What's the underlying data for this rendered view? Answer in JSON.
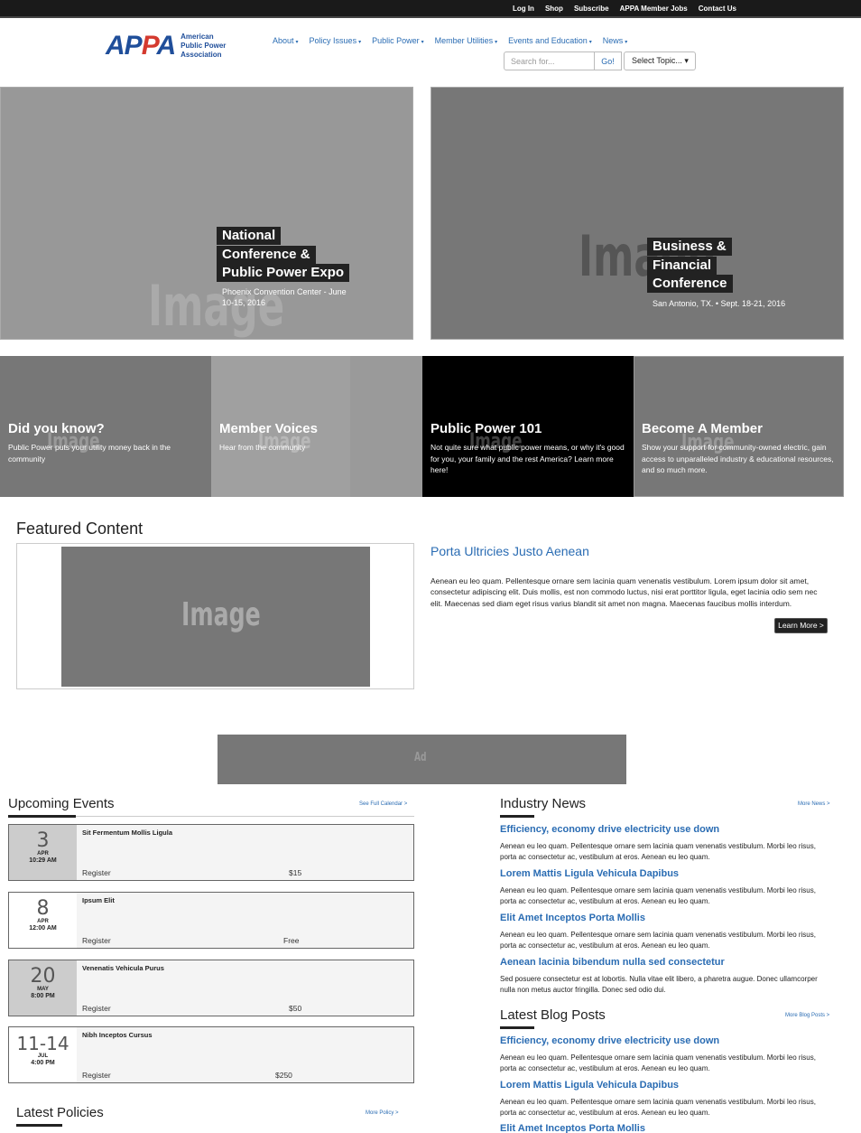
{
  "topbar": {
    "links": [
      "Log In",
      "Shop",
      "Subscribe",
      "APPA Member Jobs",
      "Contact Us"
    ]
  },
  "logo": {
    "mark_left": "AP",
    "mark_red": "P",
    "mark_right": "A",
    "text_line1": "American",
    "text_line2": "Public Power",
    "text_line3": "Association"
  },
  "nav": {
    "items": [
      "About",
      "Policy Issues",
      "Public Power",
      "Member Utilities",
      "Events and Education",
      "News"
    ],
    "caret": "▾"
  },
  "search": {
    "placeholder": "Search for...",
    "go_label": "Go!",
    "topic_label": "Select Topic... ▾"
  },
  "hero": [
    {
      "title_lines": [
        "National",
        "Conference &",
        "Public Power Expo"
      ],
      "subtitle_line1": "Phoenix Convention Center - June",
      "subtitle_line2": "10-15, 2016",
      "placeholder": "Image"
    },
    {
      "title_lines": [
        "Business &",
        "Financial",
        "Conference"
      ],
      "subtitle_line1": "San Antonio, TX. • Sept. 18-21, 2016",
      "placeholder": "Image"
    }
  ],
  "tiles": [
    {
      "title": "Did you know?",
      "desc": "Public Power puts your utility money back in the community",
      "bg": "#777777",
      "placeholder": "Image"
    },
    {
      "title": "Member Voices",
      "desc": "Hear from the community",
      "bg": "#a0a0a0",
      "placeholder": "Image"
    },
    {
      "title": "Public Power 101",
      "desc": "Not quite sure what public power means, or why it's good for you, your family and the rest America? Learn more here!",
      "bg": "#000000",
      "placeholder": "Image"
    },
    {
      "title": "Become A Member",
      "desc": "Show your support for community-owned electric, gain access to unparalleled industry & educational resources, and so much more.",
      "bg": "#777777",
      "placeholder": "Image"
    }
  ],
  "featured": {
    "heading": "Featured Content",
    "placeholder": "Image",
    "title": "Porta Ultricies Justo Aenean",
    "body": "Aenean eu leo quam. Pellentesque ornare sem lacinia quam venenatis vestibulum. Lorem ipsum dolor sit amet, consectetur adipiscing elit. Duis mollis, est non commodo luctus, nisi erat porttitor ligula, eget lacinia odio sem nec elit. Maecenas sed diam eget risus varius blandit sit amet non magna. Maecenas faucibus mollis interdum.",
    "button": "Learn More >"
  },
  "ad": {
    "label": "Ad"
  },
  "events": {
    "heading": "Upcoming Events",
    "more_link": "See Full Calendar >",
    "register_label": "Register",
    "items": [
      {
        "day": "3",
        "month": "APR",
        "time": "10:29 AM",
        "name": "Sit Fermentum Mollis Ligula",
        "price": "$15",
        "shaded": true
      },
      {
        "day": "8",
        "month": "APR",
        "time": "12:00 AM",
        "name": "Ipsum Elit",
        "price": "Free",
        "shaded": false
      },
      {
        "day": "20",
        "month": "MAY",
        "time": "8:00 PM",
        "name": "Venenatis Vehicula Purus",
        "price": "$50",
        "shaded": true
      },
      {
        "day": "11-14",
        "month": "JUL",
        "time": "4:00 PM",
        "name": "Nibh Inceptos Cursus",
        "price": "$250",
        "shaded": false
      }
    ]
  },
  "policies": {
    "heading": "Latest Policies",
    "more_link": "More Policy >"
  },
  "news": {
    "heading": "Industry News",
    "more_link": "More News >",
    "items": [
      {
        "title": "Efficiency, economy drive electricity use down",
        "body": "Aenean eu leo quam. Pellentesque ornare sem lacinia quam venenatis vestibulum. Morbi leo risus, porta ac consectetur ac, vestibulum at eros. Aenean eu leo quam."
      },
      {
        "title": "Lorem Mattis Ligula Vehicula Dapibus",
        "body": "Aenean eu leo quam. Pellentesque ornare sem lacinia quam venenatis vestibulum. Morbi leo risus, porta ac consectetur ac, vestibulum at eros. Aenean eu leo quam."
      },
      {
        "title": "Elit Amet Inceptos Porta Mollis",
        "body": "Aenean eu leo quam. Pellentesque ornare sem lacinia quam venenatis vestibulum. Morbi leo risus, porta ac consectetur ac, vestibulum at eros. Aenean eu leo quam."
      },
      {
        "title": "Aenean lacinia bibendum nulla sed consectetur",
        "body": "Sed posuere consectetur est at lobortis. Nulla vitae elit libero, a pharetra augue. Donec ullamcorper nulla non metus auctor fringilla. Donec sed odio dui."
      }
    ]
  },
  "blog": {
    "heading": "Latest Blog Posts",
    "more_link": "More Blog Posts >",
    "items": [
      {
        "title": "Efficiency, economy drive electricity use down",
        "body": "Aenean eu leo quam. Pellentesque ornare sem lacinia quam venenatis vestibulum. Morbi leo risus, porta ac consectetur ac, vestibulum at eros. Aenean eu leo quam."
      },
      {
        "title": "Lorem Mattis Ligula Vehicula Dapibus",
        "body": "Aenean eu leo quam. Pellentesque ornare sem lacinia quam venenatis vestibulum. Morbi leo risus, porta ac consectetur ac, vestibulum at eros. Aenean eu leo quam."
      },
      {
        "title": "Elit Amet Inceptos Porta Mollis"
      }
    ]
  },
  "colors": {
    "link_blue": "#2a6cb3",
    "brand_blue": "#1f4e9a",
    "brand_red": "#d43a2f",
    "topbar": "#1a1a1a"
  }
}
